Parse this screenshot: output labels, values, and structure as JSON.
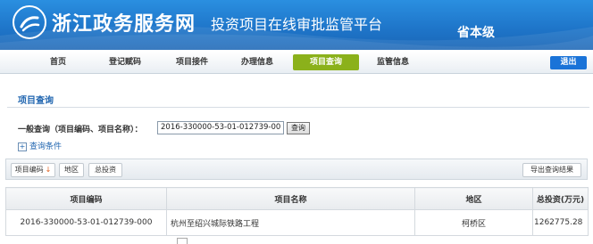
{
  "header": {
    "brand": "浙江政务服务网",
    "subtitle": "投资项目在线审批监管平台",
    "province": "省本级"
  },
  "nav": {
    "items": [
      {
        "label": "首页"
      },
      {
        "label": "登记赋码"
      },
      {
        "label": "项目接件"
      },
      {
        "label": "办理信息"
      },
      {
        "label": "项目查询",
        "active": true
      },
      {
        "label": "监管信息"
      }
    ],
    "logout_label": "退出"
  },
  "section": {
    "title": "项目查询"
  },
  "query": {
    "label": "一般查询（项目编码、项目名称）：",
    "value": "2016-330000-53-01-012739-000",
    "button": "查询",
    "conditions_label": "查询条件"
  },
  "toolbar": {
    "sort_code": "项目编码",
    "sort_region": "地区",
    "sort_invest": "总投资",
    "export": "导出查询结果"
  },
  "table": {
    "columns": [
      "项目编码",
      "项目名称",
      "地区",
      "总投资(万元)"
    ],
    "rows": [
      [
        "2016-330000-53-01-012739-000",
        "杭州至绍兴城际铁路工程",
        "柯桥区",
        "1262775.28"
      ]
    ]
  },
  "colors": {
    "banner": "#1e74c8",
    "active_tab": "#8bb11b",
    "logout": "#1a73d8",
    "title_blue": "#2166b0"
  },
  "icons": {
    "logo": "zhejiang-emblem-icon",
    "plus": "plus-square-icon",
    "sort": "down-arrow-icon"
  }
}
